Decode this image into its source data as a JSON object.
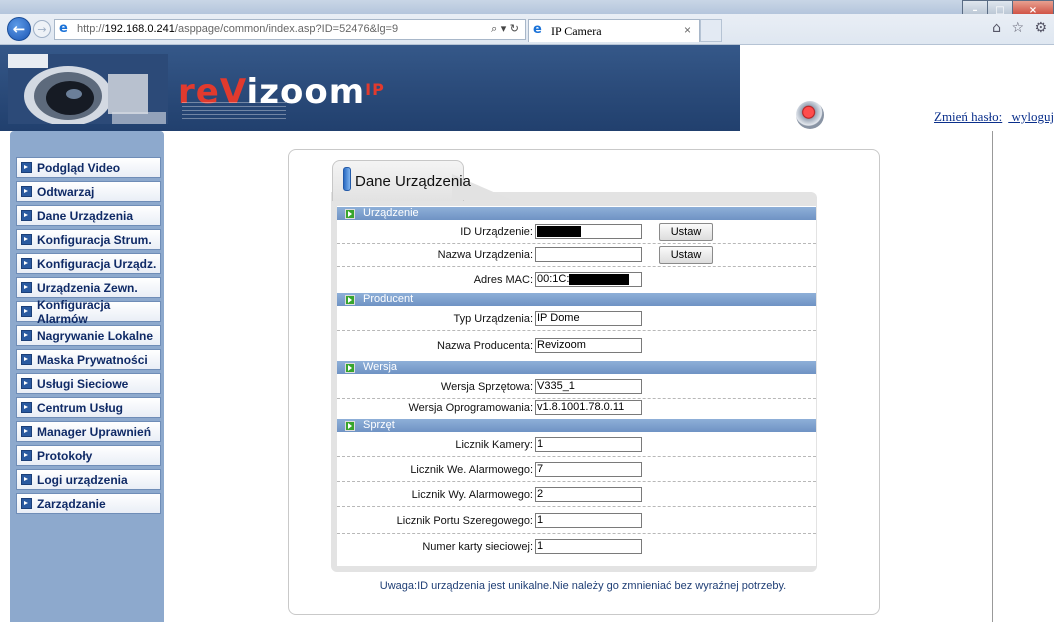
{
  "browser": {
    "url_prefix": "http://",
    "url_host": "192.168.0.241",
    "url_path": "/asppage/common/index.asp?ID=52476&lg=9",
    "tab_title": "IP Camera",
    "tab_close": "×",
    "addr_tools": "⌕ ▾ ↻",
    "right_icons": "⌂ ☆ ⚙",
    "win_min": "–",
    "win_max": "□",
    "win_close": "×"
  },
  "header": {
    "logo_re": "re",
    "logo_v": "V",
    "logo_izoom": "izoom",
    "logo_ip": "IP",
    "change_password": "Zmień hasło:",
    "logout": "wyloguj"
  },
  "menu": [
    {
      "label": "Podgląd Video"
    },
    {
      "label": "Odtwarzaj"
    },
    {
      "label": "Dane Urządzenia"
    },
    {
      "label": "Konfiguracja Strum."
    },
    {
      "label": "Konfiguracja Urządz."
    },
    {
      "label": "Urządzenia Zewn."
    },
    {
      "label": "Konfiguracja Alarmów"
    },
    {
      "label": "Nagrywanie Lokalne"
    },
    {
      "label": "Maska Prywatności"
    },
    {
      "label": "Usługi Sieciowe"
    },
    {
      "label": "Centrum Usług"
    },
    {
      "label": "Manager Uprawnień"
    },
    {
      "label": "Protokoły"
    },
    {
      "label": "Logi urządzenia"
    },
    {
      "label": "Zarządzanie"
    }
  ],
  "panel": {
    "title": "Dane Urządzenia",
    "sections": {
      "device": "Urządzenie",
      "producer": "Producent",
      "version": "Wersja",
      "hardware": "Sprzęt"
    },
    "fields": {
      "device_id_label": "ID Urządzenie:",
      "device_name_label": "Nazwa Urządzenia:",
      "device_name_value": "",
      "mac_label": "Adres MAC:",
      "mac_prefix": "00:1C:",
      "set_button": "Ustaw",
      "device_type_label": "Typ Urządzenia:",
      "device_type_value": "IP Dome",
      "producer_name_label": "Nazwa Producenta:",
      "producer_name_value": "Revizoom",
      "hw_version_label": "Wersja Sprzętowa:",
      "hw_version_value": "V335_1",
      "sw_version_label": "Wersja Oprogramowania:",
      "sw_version_value": "v1.8.1001.78.0.11",
      "camera_count_label": "Licznik Kamery:",
      "camera_count_value": "1",
      "alarm_in_label": "Licznik We. Alarmowego:",
      "alarm_in_value": "7",
      "alarm_out_label": "Licznik Wy. Alarmowego:",
      "alarm_out_value": "2",
      "serial_label": "Licznik Portu Szeregowego:",
      "serial_value": "1",
      "nic_label": "Numer karty sieciowej:",
      "nic_value": "1"
    },
    "note": "Uwaga:ID urządzenia jest unikalne.Nie należy go zmnieniać bez wyraźnej potrzeby."
  },
  "colors": {
    "header_bg": "#2a4a79",
    "sidebar_bg": "#8da9cd",
    "menu_text": "#0f2a66",
    "section_bar": "#7a9dcc",
    "logo_red": "#e13a2e",
    "link": "#0a2f8b"
  }
}
